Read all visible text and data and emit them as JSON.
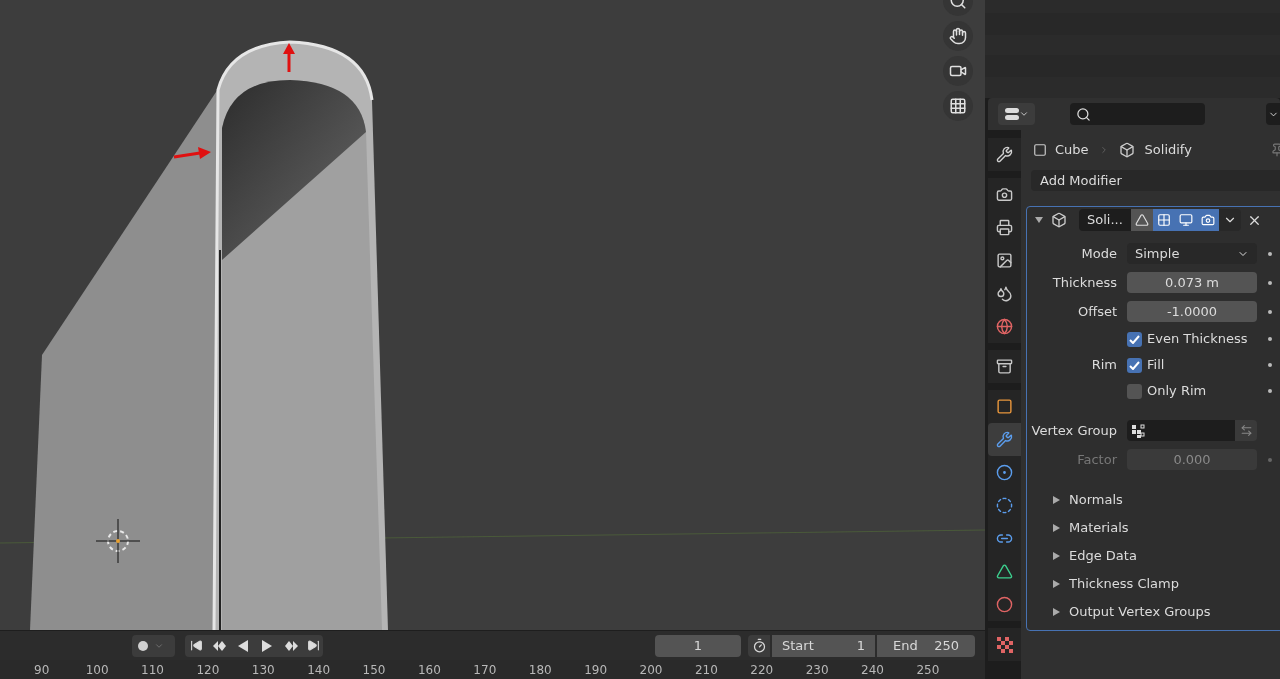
{
  "viewport": {
    "nav_buttons": [
      {
        "kind": "zoom"
      },
      {
        "kind": "pan"
      },
      {
        "kind": "camera"
      },
      {
        "kind": "ortho"
      }
    ]
  },
  "timeline": {
    "record_on": false,
    "current_frame": "1",
    "start_label": "Start",
    "start": "1",
    "end_label": "End",
    "end": "250"
  },
  "ruler": [
    "90",
    "100",
    "110",
    "120",
    "130",
    "140",
    "150",
    "160",
    "170",
    "180",
    "190",
    "200",
    "210",
    "220",
    "230",
    "240",
    "250"
  ],
  "properties": {
    "tab_groups": [
      [
        {
          "kind": "tool",
          "selected": false
        }
      ],
      [
        {
          "kind": "render",
          "selected": false
        },
        {
          "kind": "output",
          "selected": false
        },
        {
          "kind": "view_layer",
          "selected": false
        },
        {
          "kind": "scene",
          "selected": false
        },
        {
          "kind": "world",
          "selected": false
        }
      ],
      [
        {
          "kind": "collection",
          "selected": false
        }
      ],
      [
        {
          "kind": "object",
          "selected": false
        },
        {
          "kind": "modifier",
          "selected": true
        },
        {
          "kind": "particles",
          "selected": false
        },
        {
          "kind": "physics",
          "selected": false
        },
        {
          "kind": "constraints",
          "selected": false
        },
        {
          "kind": "data",
          "selected": false
        },
        {
          "kind": "material",
          "selected": false
        }
      ],
      [
        {
          "kind": "texture",
          "selected": false
        }
      ]
    ],
    "breadcrumb": [
      "Cube",
      "Solidify"
    ],
    "add_modifier": "Add Modifier",
    "modifier": {
      "name": "Soli...",
      "expanded": true,
      "edit_mode": false,
      "on_cage": true,
      "viewport": true,
      "render": true,
      "rows": [
        {
          "kind": "dropdown",
          "label": "Mode",
          "value": "Simple"
        },
        {
          "kind": "number",
          "label": "Thickness",
          "value": "0.073 m",
          "disabled": false
        },
        {
          "kind": "number",
          "label": "Offset",
          "value": "-1.0000",
          "disabled": false
        },
        {
          "kind": "checkbox",
          "text": "Even Thickness",
          "checked": true
        },
        {
          "kind": "checkbox",
          "label": "Rim",
          "text": "Fill",
          "checked": true
        },
        {
          "kind": "checkbox",
          "text": "Only Rim",
          "checked": false
        },
        {
          "kind": "vertex_group",
          "label": "Vertex Group"
        },
        {
          "kind": "number",
          "label": "Factor",
          "value": "0.000",
          "disabled": true
        }
      ],
      "subpanels": [
        {
          "label": "Normals",
          "expanded": false
        },
        {
          "label": "Materials",
          "expanded": false
        },
        {
          "label": "Edge Data",
          "expanded": false
        },
        {
          "label": "Thickness Clamp",
          "expanded": false
        },
        {
          "label": "Output Vertex Groups",
          "expanded": false
        }
      ]
    }
  }
}
